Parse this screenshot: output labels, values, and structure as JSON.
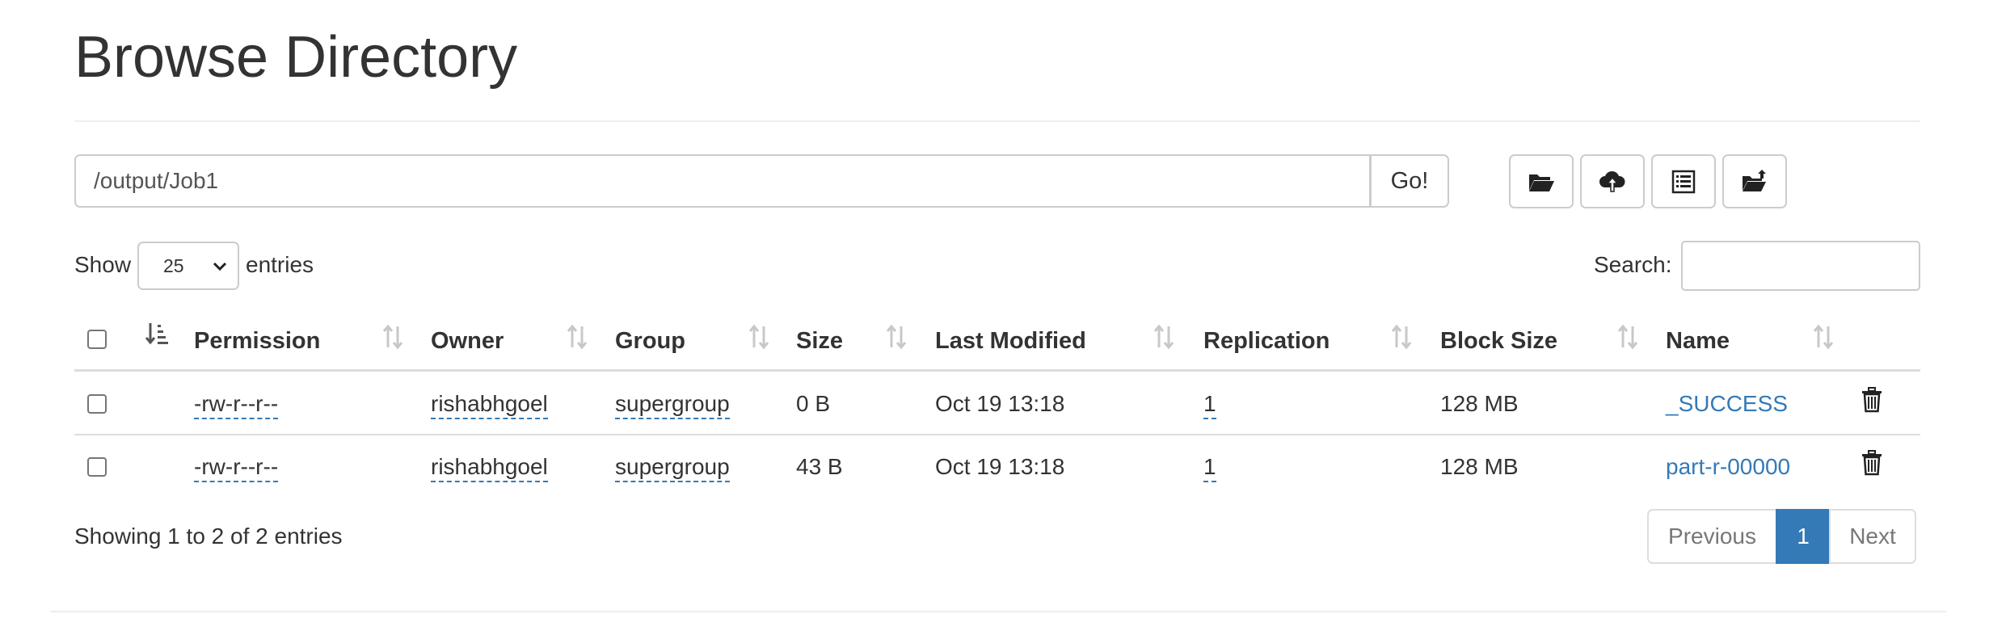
{
  "page": {
    "title": "Browse Directory"
  },
  "path_bar": {
    "value": "/output/Job1",
    "go_label": "Go!"
  },
  "toolbar": {
    "buttons": [
      {
        "icon": "folder-open-icon"
      },
      {
        "icon": "cloud-upload-icon"
      },
      {
        "icon": "list-alt-icon"
      },
      {
        "icon": "folder-upload-icon"
      }
    ]
  },
  "length_control": {
    "show_label": "Show",
    "selected": "25",
    "entries_label": "entries"
  },
  "search": {
    "label": "Search:",
    "value": ""
  },
  "table": {
    "columns": [
      "Permission",
      "Owner",
      "Group",
      "Size",
      "Last Modified",
      "Replication",
      "Block Size",
      "Name"
    ],
    "rows": [
      {
        "permission": "-rw-r--r--",
        "owner": "rishabhgoel",
        "group": "supergroup",
        "size": "0 B",
        "last_modified": "Oct 19 13:18",
        "replication": "1",
        "block_size": "128 MB",
        "name": "_SUCCESS"
      },
      {
        "permission": "-rw-r--r--",
        "owner": "rishabhgoel",
        "group": "supergroup",
        "size": "43 B",
        "last_modified": "Oct 19 13:18",
        "replication": "1",
        "block_size": "128 MB",
        "name": "part-r-00000"
      }
    ]
  },
  "footer": {
    "info": "Showing 1 to 2 of 2 entries",
    "pagination": {
      "previous": "Previous",
      "current": "1",
      "next": "Next"
    }
  },
  "colors": {
    "link": "#337ab7",
    "active_page": "#337ab7",
    "border": "#cccccc"
  }
}
